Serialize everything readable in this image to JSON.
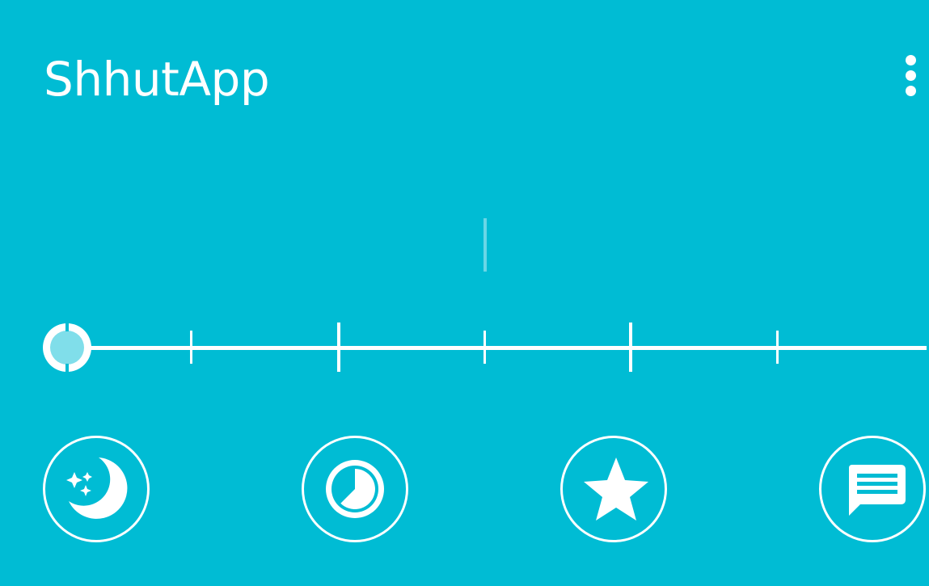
{
  "app": {
    "title": "ShhutApp"
  },
  "colors": {
    "background": "#00BCD4",
    "foreground": "#FFFFFF",
    "thumb_fill": "#80DEEA",
    "cursor": "#6AD6E6"
  },
  "menu": {
    "icon": "more-vert-icon"
  },
  "slider": {
    "value_fraction": 0,
    "tick_count": 6,
    "major_ticks": [
      2,
      4
    ]
  },
  "actions": [
    {
      "name": "sleep-mode",
      "icon": "moon-stars-icon"
    },
    {
      "name": "timer",
      "icon": "timer-icon"
    },
    {
      "name": "favorites",
      "icon": "star-icon"
    },
    {
      "name": "messages",
      "icon": "message-icon"
    }
  ]
}
